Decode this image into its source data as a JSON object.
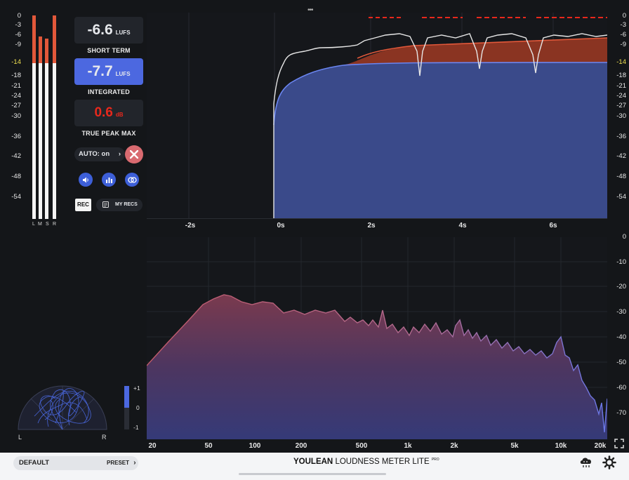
{
  "meter": {
    "scale": [
      "0",
      "-3",
      "-6",
      "-9",
      "-14",
      "-18",
      "-21",
      "-24",
      "-27",
      "-30",
      "-36",
      "-42",
      "-48",
      "-54"
    ],
    "channels": [
      "L",
      "M",
      "S",
      "R"
    ],
    "levels": [
      {
        "white_top": -0.5,
        "red_top": -0.5
      },
      {
        "white_top": -6.3,
        "red_top": -6.3
      },
      {
        "white_top": -7.2,
        "red_top": -7.2
      },
      {
        "white_top": -0.5,
        "red_top": -0.5
      }
    ]
  },
  "readouts": {
    "short_term": {
      "value": "-6.6",
      "unit": "LUFS",
      "caption": "SHORT TERM"
    },
    "integrated": {
      "value": "-7.7",
      "unit": "LUFS",
      "caption": "INTEGRATED"
    },
    "true_peak": {
      "value": "0.6",
      "unit": "dB",
      "caption": "TRUE PEAK MAX"
    }
  },
  "controls": {
    "auto_label": "AUTO: on",
    "auto_arrow": "›",
    "close_icon": "close-icon",
    "icons": [
      "speaker-icon",
      "histogram-icon",
      "stereo-icon"
    ],
    "rec_label": "REC",
    "my_recs_label": "MY RECS"
  },
  "colors": {
    "accent": "#4c68e0",
    "red": "#e2583a",
    "peak_red": "#e8281c",
    "target_yellow": "#f0e050",
    "close_btn": "#d96a70"
  },
  "history": {
    "y_scale": [
      "0",
      "-3",
      "-6",
      "-9",
      "-14",
      "-18",
      "-21",
      "-24",
      "-27",
      "-30",
      "-36",
      "-42",
      "-48",
      "-54"
    ],
    "x_labels": [
      "-2s",
      "0s",
      "2s",
      "4s",
      "6s"
    ],
    "target_lufs": -14
  },
  "spectrum": {
    "y_scale": [
      "0",
      "-10",
      "-20",
      "-30",
      "-40",
      "-50",
      "-60",
      "-70"
    ],
    "x_labels": [
      "20",
      "50",
      "100",
      "200",
      "500",
      "1k",
      "2k",
      "5k",
      "10k",
      "20k"
    ]
  },
  "stereo": {
    "left_label": "L",
    "right_label": "R",
    "corr_scale": [
      "+1",
      "0",
      "-1"
    ]
  },
  "footer": {
    "preset_name": "DEFAULT",
    "preset_button": "PRESET",
    "preset_arrow": "›",
    "brand_bold": "YOULEAN",
    "brand_rest": "LOUDNESS METER LITE",
    "brand_sup": "PRO",
    "icons": [
      "cloud-icon",
      "settings-gear-icon"
    ]
  },
  "top_handle": "•••",
  "expand_icon": "fullscreen-icon"
}
